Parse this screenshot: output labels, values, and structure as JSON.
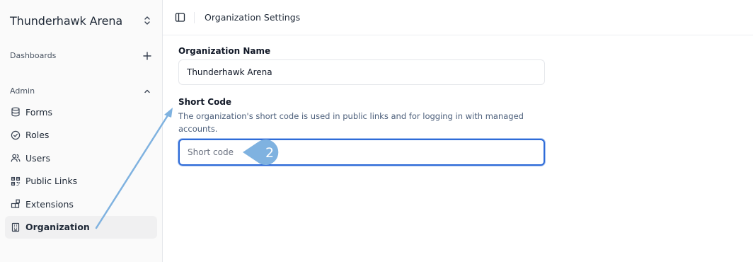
{
  "sidebar": {
    "org_name": "Thunderhawk Arena",
    "dashboards_label": "Dashboards",
    "admin_label": "Admin",
    "items": [
      {
        "label": "Forms",
        "icon": "database-icon"
      },
      {
        "label": "Roles",
        "icon": "check-circle-icon"
      },
      {
        "label": "Users",
        "icon": "users-icon"
      },
      {
        "label": "Public Links",
        "icon": "qr-code-icon"
      },
      {
        "label": "Extensions",
        "icon": "blocks-icon"
      },
      {
        "label": "Organization",
        "icon": "building-icon",
        "active": true
      }
    ]
  },
  "header": {
    "title": "Organization Settings"
  },
  "form": {
    "org_name_label": "Organization Name",
    "org_name_value": "Thunderhawk Arena",
    "short_code_label": "Short Code",
    "short_code_desc": "The organization's short code is used in public links and for logging in with managed accounts.",
    "short_code_value": "",
    "short_code_placeholder": "Short code"
  },
  "annotation": {
    "step": "2",
    "color": "#7fb2e0"
  },
  "colors": {
    "focus_ring": "#2e6bd8",
    "active_bg": "#f0f0f1"
  }
}
